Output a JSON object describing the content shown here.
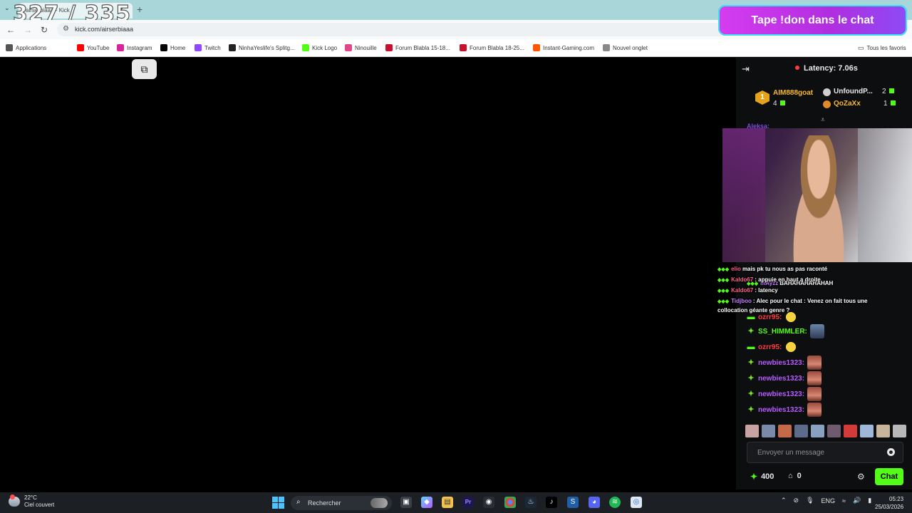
{
  "overlay": {
    "counter": "327 / 335",
    "donation_banner": "Tape !don dans le chat"
  },
  "browser": {
    "tab_title": "airserbiaaa - Kick",
    "url": "kick.com/airserbiaaa",
    "bookmarks": [
      {
        "label": "Applications",
        "icon": "apps-grid-icon",
        "color": "#555555"
      },
      {
        "label": "YouTube",
        "icon": "youtube-icon",
        "color": "#ff0000"
      },
      {
        "label": "Instagram",
        "icon": "instagram-icon",
        "color": "#d6249f"
      },
      {
        "label": "Home",
        "icon": "x-icon",
        "color": "#000000"
      },
      {
        "label": "Twitch",
        "icon": "twitch-icon",
        "color": "#9146ff"
      },
      {
        "label": "NinhaYeslife's Splitg...",
        "icon": "site-icon",
        "color": "#222222"
      },
      {
        "label": "Kick Logo",
        "icon": "kick-icon",
        "color": "#53fc18"
      },
      {
        "label": "Ninouille",
        "icon": "site-icon",
        "color": "#e0468a"
      },
      {
        "label": "Forum Blabla 15-18...",
        "icon": "jv-icon",
        "color": "#c8102e"
      },
      {
        "label": "Forum Blabla 18-25...",
        "icon": "jv-icon",
        "color": "#c8102e"
      },
      {
        "label": "Instant-Gaming.com",
        "icon": "instant-gaming-icon",
        "color": "#ff5400"
      },
      {
        "label": "Nouvel onglet",
        "icon": "page-icon",
        "color": "#888888"
      }
    ],
    "all_favorites": "Tous les favoris"
  },
  "chat": {
    "latency": "Latency: 7.06s",
    "leaderboard": [
      {
        "rank": "1",
        "name": "AIM888goat",
        "count": "4",
        "color": "#f5b82e"
      },
      {
        "name": "UnfoundP...",
        "count": "2",
        "color": "#e8e8e8"
      },
      {
        "name": "QoZaXx",
        "count": "1",
        "color": "#f5b82e"
      }
    ],
    "partial_user": "Aleksa:",
    "overlay_messages": [
      {
        "user": "elio",
        "text": "mais pk tu nous as pas raconté",
        "color": "#ff5c8a"
      },
      {
        "user": "mAyzz",
        "text": "BAHAHAHAHAHAH",
        "color": "#c77dff"
      },
      {
        "user": "Kaldo67",
        "text": ": appuie en haut a droite",
        "color": "#ff5c8a"
      },
      {
        "user": "Kaldo67",
        "text": ": latency",
        "color": "#ff5c8a"
      },
      {
        "user": "Tidjboo",
        "text": ": Alec pour le chat : Venez on fait tous une",
        "color": "#c77dff"
      },
      {
        "user": "",
        "text": "collocation géante genre ?",
        "color": "#ffffff"
      }
    ],
    "messages": [
      {
        "user": "ozrr95:",
        "color": "#ff3b3b",
        "badge": "sub-badge",
        "emote": "yellow"
      },
      {
        "user": "SS_HIMMLER:",
        "color": "#53fc18",
        "badge": "og-badge",
        "emote": "pic"
      },
      {
        "user": "ozrr95:",
        "color": "#ff3b3b",
        "badge": "sub-badge",
        "emote": "yellow"
      },
      {
        "user": "newbies1323:",
        "color": "#b95cff",
        "badge": "og-badge",
        "emote": "face"
      },
      {
        "user": "newbies1323:",
        "color": "#b95cff",
        "badge": "og-badge",
        "emote": "face"
      },
      {
        "user": "newbies1323:",
        "color": "#b95cff",
        "badge": "og-badge",
        "emote": "face"
      },
      {
        "user": "newbies1323:",
        "color": "#b95cff",
        "badge": "og-badge",
        "emote": "face"
      }
    ],
    "input_placeholder": "Envoyer un message",
    "points": "400",
    "subs": "0",
    "send_label": "Chat"
  },
  "taskbar": {
    "temperature": "22°C",
    "weather": "Ciel couvert",
    "search_label": "Rechercher",
    "language": "ENG",
    "time": "05:23",
    "date": "25/03/2026"
  }
}
